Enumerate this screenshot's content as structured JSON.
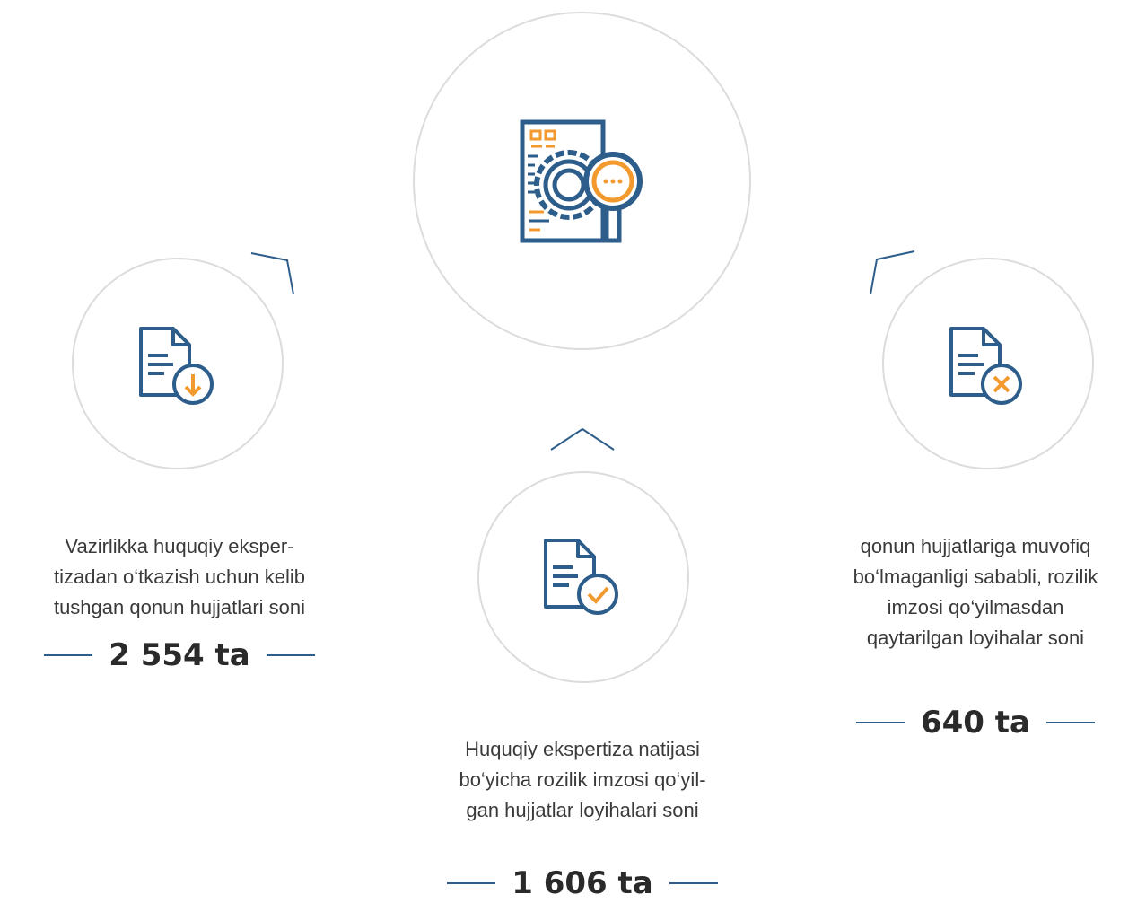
{
  "colors": {
    "accent_blue": "#2d5d8a",
    "accent_orange": "#f29a2e",
    "circle_border": "#dcdcdc"
  },
  "center": {
    "icon": "document-gear-magnifier-icon"
  },
  "items": [
    {
      "icon": "document-download-icon",
      "description": [
        "Vazirlikka huquqiy eksper-",
        "tizadan o‘tkazish uchun kelib",
        "tushgan qonun hujjatlari soni"
      ],
      "stat": "2 554 ta"
    },
    {
      "icon": "document-check-icon",
      "description": [
        "Huquqiy ekspertiza natijasi",
        "bo‘yicha rozilik imzosi qo‘yil-",
        "gan hujjatlar loyihalari soni"
      ],
      "stat": "1 606 ta"
    },
    {
      "icon": "document-reject-icon",
      "description": [
        "qonun hujjatlariga muvofiq",
        "bo‘lmaganligi sababli, rozilik",
        "imzosi qo‘yilmasdan",
        "qaytarilgan loyihalar soni"
      ],
      "stat": "640 ta"
    }
  ]
}
